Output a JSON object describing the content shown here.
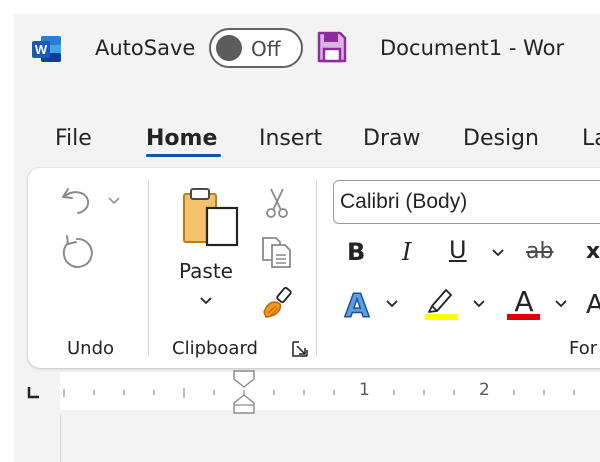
{
  "titlebar": {
    "autosave_label": "AutoSave",
    "autosave_state": "Off",
    "document_title": "Document1  -  Wor"
  },
  "tabs": [
    {
      "label": "File",
      "active": false
    },
    {
      "label": "Home",
      "active": true
    },
    {
      "label": "Insert",
      "active": false
    },
    {
      "label": "Draw",
      "active": false
    },
    {
      "label": "Design",
      "active": false
    },
    {
      "label": "La",
      "active": false
    }
  ],
  "ribbon": {
    "undo_group_label": "Undo",
    "clipboard_group_label": "Clipboard",
    "paste_label": "Paste",
    "font_group_label": "For",
    "font_name": "Calibri (Body)",
    "bold_label": "B",
    "italic_label": "I",
    "underline_label": "U",
    "strike_label": "ab",
    "subscript_label": "x",
    "font_color_letter": "A",
    "text_effects_letter": "A",
    "grow_letter": "A"
  },
  "ruler": {
    "marks": [
      "1",
      "2"
    ]
  },
  "colors": {
    "accent": "#1e4e9e",
    "highlight": "#ffff00",
    "font_color": "#e00000",
    "word_blue": "#185abd",
    "save_purple": "#8e2c9c"
  }
}
